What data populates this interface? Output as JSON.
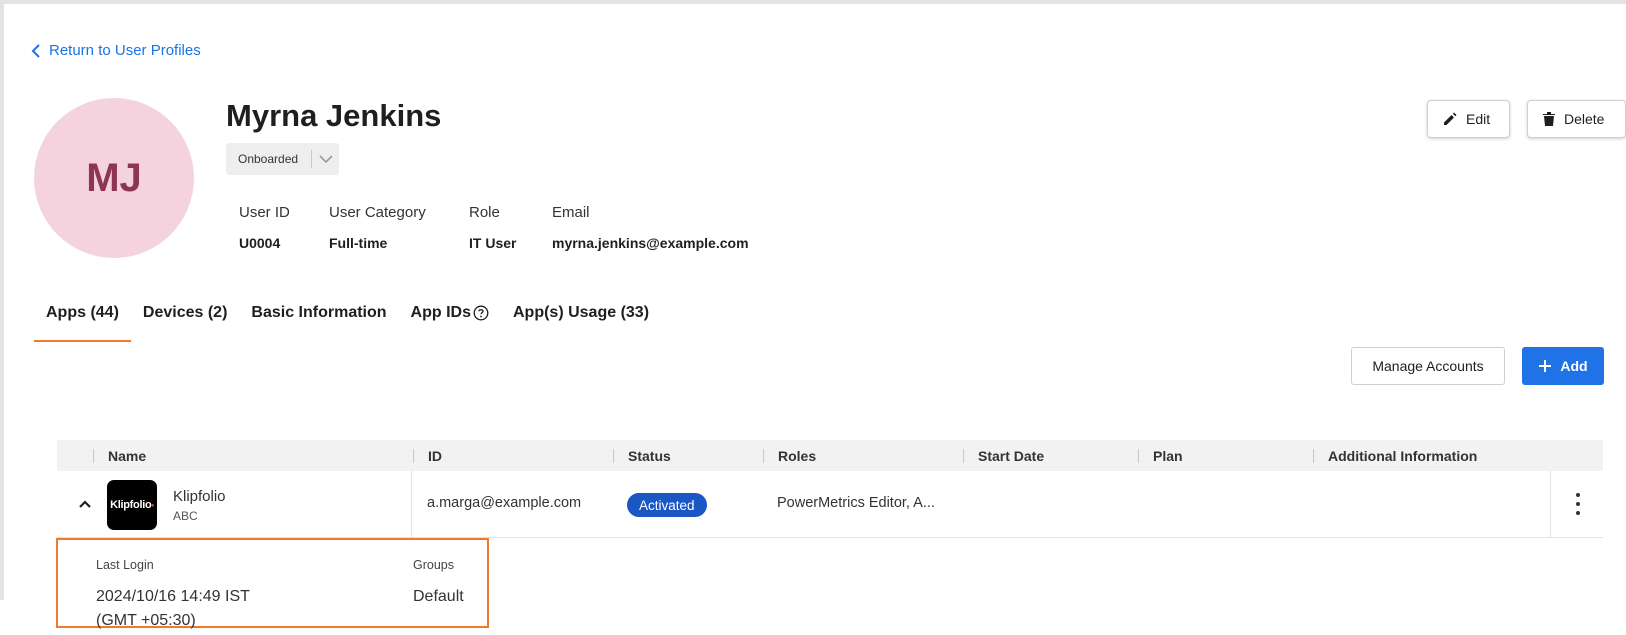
{
  "back_link": "Return to User Profiles",
  "user": {
    "initials": "MJ",
    "name": "Myrna Jenkins",
    "status": "Onboarded"
  },
  "actions": {
    "edit": "Edit",
    "delete": "Delete"
  },
  "meta": [
    {
      "label": "User ID",
      "value": "U0004"
    },
    {
      "label": "User Category",
      "value": "Full-time"
    },
    {
      "label": "Role",
      "value": "IT User"
    },
    {
      "label": "Email",
      "value": "myrna.jenkins@example.com"
    }
  ],
  "tabs": [
    {
      "label": "Apps (44)",
      "active": true
    },
    {
      "label": "Devices (2)"
    },
    {
      "label": "Basic Information"
    },
    {
      "label": "App IDs"
    },
    {
      "label": "App(s) Usage (33)"
    }
  ],
  "toolbar": {
    "manage": "Manage Accounts",
    "add": "Add"
  },
  "table": {
    "headers": [
      "Name",
      "ID",
      "Status",
      "Roles",
      "Start Date",
      "Plan",
      "Additional Information"
    ],
    "row": {
      "logo_text": "Klipfolio",
      "name": "Klipfolio",
      "sub": "ABC",
      "id": "a.marga@example.com",
      "status": "Activated",
      "roles": "PowerMetrics Editor, A...",
      "start_date": "",
      "plan": "",
      "additional": ""
    },
    "detail": {
      "last_login_label": "Last Login",
      "last_login_value_1": "2024/10/16 14:49 IST",
      "last_login_value_2": "(GMT +05:30)",
      "groups_label": "Groups",
      "groups_value": "Default"
    }
  },
  "colors": {
    "accent": "#1f73e6",
    "tab_indicator": "#f07a2a",
    "badge": "#1a56c4",
    "avatar_bg": "#f4d3de",
    "avatar_text": "#8e3552"
  }
}
